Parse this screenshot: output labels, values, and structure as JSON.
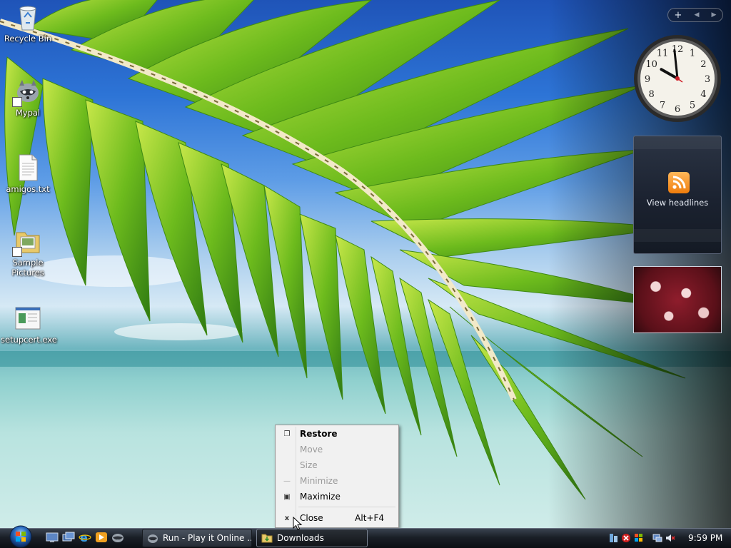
{
  "desktop": {
    "icons": [
      {
        "label": "Recycle Bin"
      },
      {
        "label": "Mypal"
      },
      {
        "label": "amigos.txt"
      },
      {
        "label": "Sample Pictures"
      },
      {
        "label": "setupcert.exe"
      }
    ]
  },
  "gadgets": {
    "controls": {
      "add": "+",
      "prev": "◀",
      "next": "▶"
    },
    "clock": {
      "numbers": [
        "12",
        "1",
        "2",
        "3",
        "4",
        "5",
        "6",
        "7",
        "8",
        "9",
        "10",
        "11"
      ],
      "hour": 9,
      "minute": 59
    },
    "news": {
      "label": "View headlines"
    }
  },
  "context_menu": {
    "items": [
      {
        "label": "Restore",
        "state": "default",
        "icon": "restore-icon"
      },
      {
        "label": "Move",
        "state": "disabled",
        "icon": ""
      },
      {
        "label": "Size",
        "state": "disabled",
        "icon": ""
      },
      {
        "label": "Minimize",
        "state": "disabled",
        "icon": "minimize-icon"
      },
      {
        "label": "Maximize",
        "state": "enabled",
        "icon": "maximize-icon"
      },
      {
        "label": "Close",
        "state": "enabled",
        "icon": "close-icon",
        "shortcut": "Alt+F4"
      }
    ]
  },
  "taskbar": {
    "buttons": [
      {
        "label": "Run - Play it Online ..."
      },
      {
        "label": "Downloads"
      }
    ],
    "tray": {
      "time": "9:59 PM"
    }
  },
  "colors": {
    "taskbar_bg": "#1a1f27",
    "menu_bg": "#f1f1f1",
    "rss_orange": "#f07d0c"
  }
}
